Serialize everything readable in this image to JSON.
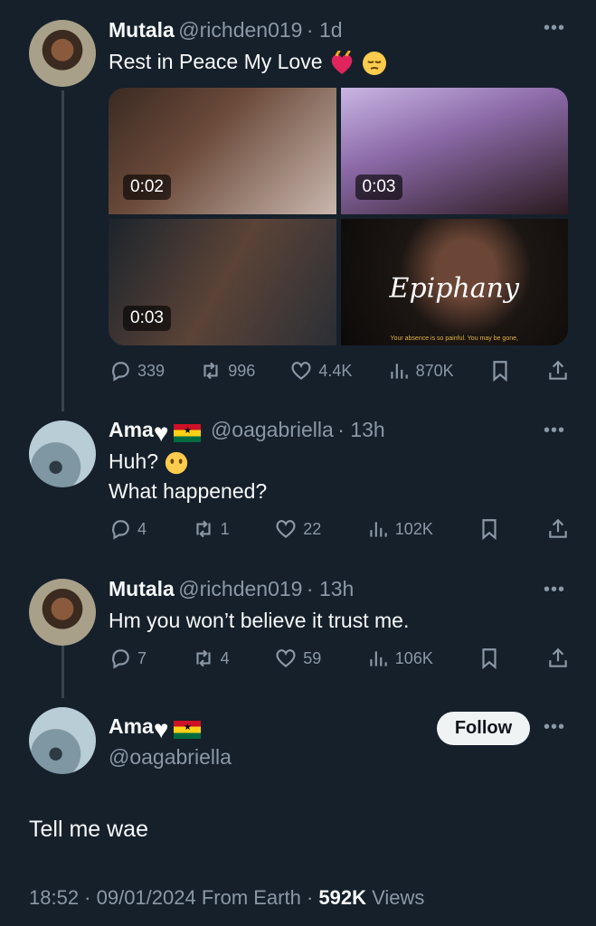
{
  "colors": {
    "background": "#15202b",
    "text": "#f7f9f9",
    "muted": "#8b98a5",
    "follow_bg": "#eff3f4"
  },
  "tweet1": {
    "name": "Mutala",
    "handle": "@richden019",
    "time": "· 1d",
    "text": "Rest in Peace My Love",
    "emoji": [
      "heart-on-fire",
      "pensive-face"
    ],
    "media": [
      {
        "duration": "0:02"
      },
      {
        "duration": "0:03"
      },
      {
        "duration": "0:03"
      },
      {
        "title": "Epiphany",
        "subtitle": "Your absence is so painful. You may be gone,"
      }
    ],
    "actions": {
      "replies": "339",
      "reposts": "996",
      "likes": "4.4K",
      "views": "870K"
    }
  },
  "tweet2": {
    "name": "Ama",
    "handle": "@oagabriella",
    "time": "· 13h",
    "text_line1": "Huh?",
    "text_line2": "What happened?",
    "actions": {
      "replies": "4",
      "reposts": "1",
      "likes": "22",
      "views": "102K"
    }
  },
  "tweet3": {
    "name": "Mutala",
    "handle": "@richden019",
    "time": "· 13h",
    "text": "Hm you won’t believe it trust me.",
    "actions": {
      "replies": "7",
      "reposts": "4",
      "likes": "59",
      "views": "106K"
    }
  },
  "main_tweet": {
    "name": "Ama",
    "handle": "@oagabriella",
    "follow_label": "Follow",
    "text": "Tell me wae",
    "meta_time": "18:52 · 09/01/2024 From Earth · ",
    "views_count": "592K",
    "views_label": " Views"
  }
}
